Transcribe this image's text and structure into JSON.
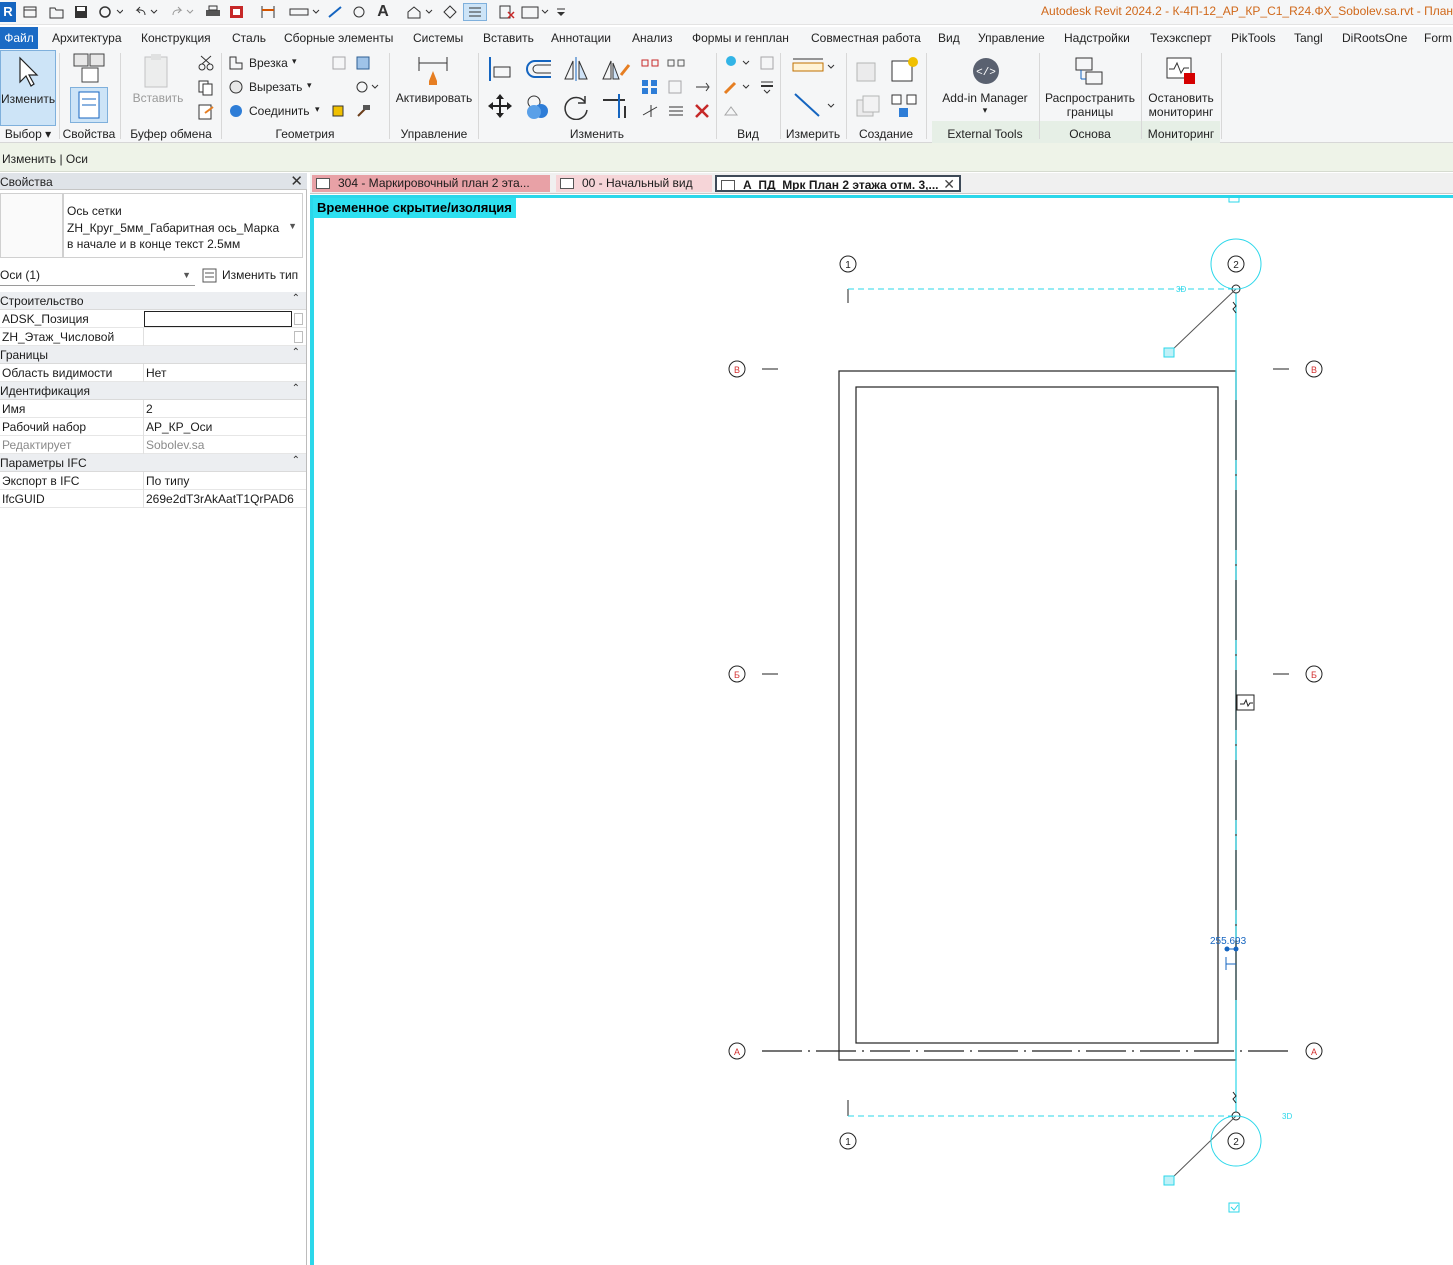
{
  "window": {
    "title": "Autodesk Revit 2024.2 - К-4П-12_АР_КР_С1_R24.ФХ_Sobolev.sa.rvt - План"
  },
  "quick_access": {
    "logo": "R",
    "icons": [
      "home-icon",
      "open-icon",
      "save-icon",
      "sync-icon",
      "undo-icon",
      "redo-icon",
      "print-icon",
      "export-icon",
      "measure-icon",
      "dimension-icon",
      "text-icon",
      "3d-view-icon",
      "section-icon",
      "thin-lines-icon",
      "close-hidden-icon",
      "switch-windows-icon",
      "customize-icon"
    ]
  },
  "menu": {
    "file": "Файл",
    "tabs": [
      "Архитектура",
      "Конструкция",
      "Сталь",
      "Сборные элементы",
      "Системы",
      "Вставить",
      "Аннотации",
      "Анализ",
      "Формы и генплан",
      "Совместная работа",
      "Вид",
      "Управление",
      "Надстройки",
      "Техэксперт",
      "PikTools",
      "Tangl",
      "DiRootsOne",
      "Form"
    ]
  },
  "ribbon": {
    "modify_label": "Изменить",
    "select_label": "Выбор ▾",
    "properties_label": "Свойства",
    "paste_label": "Вставить",
    "clipboard_label": "Буфер обмена",
    "cope_label": "Врезка",
    "cut_label": "Вырезать",
    "join_label": "Соединить",
    "geometry_label": "Геометрия",
    "activate_label": "Активировать",
    "control_label": "Управление",
    "modify_group_label": "Изменить",
    "view_label": "Вид",
    "measure_label": "Измерить",
    "create_label": "Создание",
    "addin_manager_label": "Add-in Manager",
    "external_tools_label": "External Tools",
    "propagate_label_1": "Распространить",
    "propagate_label_2": "границы",
    "datum_label": "Основа",
    "stop_monitor_label_1": "Остановить",
    "stop_monitor_label_2": "мониторинг",
    "monitoring_label": "Мониторинг"
  },
  "context": {
    "text": "Изменить | Оси"
  },
  "properties": {
    "title": "Свойства",
    "type_family": "Ось сетки",
    "type_name": "ZH_Круг_5мм_Габаритная ось_Марка в начале и в конце текст 2.5мм",
    "filter": "Оси (1)",
    "edit_type": "Изменить тип",
    "categories": [
      {
        "name": "Строительство",
        "rows": [
          {
            "name": "ADSK_Позиция",
            "value": "",
            "input": true
          },
          {
            "name": "ZH_Этаж_Числовой",
            "value": "",
            "checkbox": true
          }
        ]
      },
      {
        "name": "Границы",
        "rows": [
          {
            "name": "Область видимости",
            "value": "Нет"
          }
        ]
      },
      {
        "name": "Идентификация",
        "rows": [
          {
            "name": "Имя",
            "value": "2"
          },
          {
            "name": "Рабочий набор",
            "value": "АР_КР_Оси"
          },
          {
            "name": "Редактирует",
            "value": "Sobolev.sa",
            "gray": true
          }
        ]
      },
      {
        "name": "Параметры IFC",
        "rows": [
          {
            "name": "Экспорт в IFC",
            "value": "По типу"
          },
          {
            "name": "IfcGUID",
            "value": "269e2dT3rAkAatT1QrPAD6"
          }
        ]
      }
    ]
  },
  "view_tabs": [
    {
      "label": "304 - Маркировочный план 2 эта..."
    },
    {
      "label": "00 - Начальный вид"
    },
    {
      "label": "А_ПД_Мрк План 2 этажа отм. 3,..."
    }
  ],
  "canvas": {
    "isolation_label": "Временное скрытие/изоляция",
    "grid_bubbles": {
      "one_top": "1",
      "two_top": "2",
      "one_bottom": "1",
      "two_bottom": "2",
      "v_left": "В",
      "v_right": "В",
      "b_left": "Б",
      "b_right": "Б",
      "a_left": "А",
      "a_right": "А"
    },
    "label_3d_top": "3D",
    "label_3d_bottom": "3D",
    "dimension_value": "255.693",
    "colors": {
      "selection": "#2bd7ea",
      "grid_red": "#d32f2f",
      "dimension": "#1565c0"
    }
  }
}
